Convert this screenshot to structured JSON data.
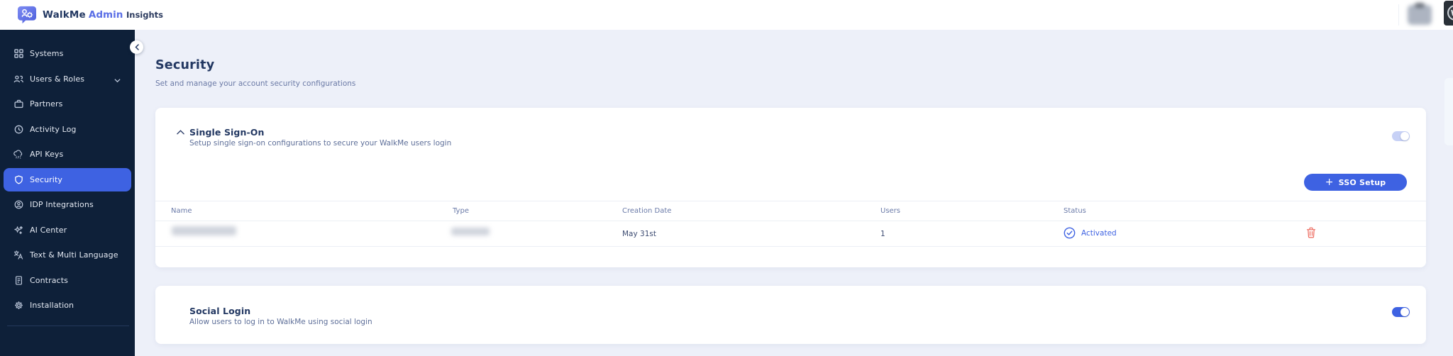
{
  "topbar": {
    "brand": {
      "product": "WalkMe",
      "suffix": "Admin",
      "logo_icon": "walkme-bubble-logo-icon"
    },
    "nav": [
      {
        "label": "Insights"
      }
    ],
    "right": {
      "avatar": "blurred-user-avatar",
      "corner_app_icon": "dark-app-emblem-icon"
    }
  },
  "sidebar": {
    "collapse_icon": "chevron-left-icon",
    "items": [
      {
        "label": "Systems",
        "icon": "grid-icon",
        "active": false
      },
      {
        "label": "Users & Roles",
        "icon": "users-icon",
        "active": false,
        "has_chevron": true
      },
      {
        "label": "Partners",
        "icon": "briefcase-icon",
        "active": false
      },
      {
        "label": "Activity Log",
        "icon": "clock-icon",
        "active": false
      },
      {
        "label": "API Keys",
        "icon": "api-cloud-icon",
        "active": false
      },
      {
        "label": "Security",
        "icon": "shield-icon",
        "active": true
      },
      {
        "label": "IDP Integrations",
        "icon": "person-circle-icon",
        "active": false
      },
      {
        "label": "AI Center",
        "icon": "sparkles-icon",
        "active": false
      },
      {
        "label": "Text & Multi Language",
        "icon": "translate-icon",
        "active": false
      },
      {
        "label": "Contracts",
        "icon": "document-icon",
        "active": false
      },
      {
        "label": "Installation",
        "icon": "gear-icon",
        "active": false
      }
    ]
  },
  "page": {
    "title": "Security",
    "subtitle": "Set and manage your account security configurations"
  },
  "sso": {
    "title": "Single Sign-On",
    "subtitle": "Setup single sign-on configurations to secure your WalkMe users login",
    "collapse_icon": "chevron-up-icon",
    "toggle": {
      "state": "on",
      "style": "light-disabled"
    },
    "setup_button_label": "SSO Setup",
    "table": {
      "columns": [
        "Name",
        "Type",
        "Creation Date",
        "Users",
        "Status"
      ],
      "rows": [
        {
          "name_redacted": true,
          "type_redacted": true,
          "creation_date": "May 31st",
          "users": "1",
          "status": "Activated",
          "status_icon": "check-circle-icon",
          "row_action_icon": "trash-icon"
        }
      ]
    }
  },
  "social": {
    "title": "Social Login",
    "subtitle": "Allow users to log in to WalkMe using social login",
    "toggle": {
      "state": "on",
      "style": "active"
    }
  },
  "colors": {
    "accent_blue": "#3E62E2",
    "sidebar_navy": "#0E2039",
    "content_bg": "#EDF0F9",
    "title_navy": "#233862",
    "muted_blue_gray": "#6A7AA8",
    "danger_red": "#ED6A5E",
    "toggle_light": "#C7D1F6",
    "brand_purple": "#5B6FE6"
  }
}
